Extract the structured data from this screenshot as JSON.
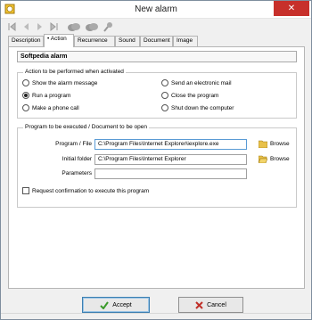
{
  "window": {
    "title": "New alarm",
    "close_glyph": "✕"
  },
  "toolbar": {
    "icons": [
      "first-icon",
      "prev-icon",
      "next-icon",
      "last-icon",
      "cloud-icon",
      "cloud-icon",
      "key-icon"
    ]
  },
  "tabs": [
    "Description",
    "Action",
    "Recurrence",
    "Sound",
    "Document",
    "Image"
  ],
  "active_tab": "Action",
  "alarm_name": "Softpedia alarm",
  "action_group": {
    "legend": "Action to be performed when activated",
    "options": [
      {
        "label": "Show the alarm message",
        "selected": false
      },
      {
        "label": "Send an electronic mail",
        "selected": false
      },
      {
        "label": "Run a program",
        "selected": true
      },
      {
        "label": "Close the program",
        "selected": false
      },
      {
        "label": "Make a phone call",
        "selected": false
      },
      {
        "label": "Shut down the computer",
        "selected": false
      }
    ]
  },
  "program_group": {
    "legend": "Program to be executed / Document to be open",
    "program_label": "Program / File",
    "program_value": "C:\\Program Files\\Internet Explorer\\iexplore.exe",
    "folder_label": "Initial folder",
    "folder_value": "C:\\Program Files\\Internet Explorer",
    "params_label": "Parameters",
    "params_value": "",
    "browse_label": "Browse",
    "confirm_label": "Request confirmation to execute this program",
    "confirm_checked": false
  },
  "buttons": {
    "accept": "Accept",
    "cancel": "Cancel"
  },
  "colors": {
    "close_red": "#c7302b",
    "accept_green": "#3a9a2a",
    "cancel_red": "#c0302a"
  }
}
